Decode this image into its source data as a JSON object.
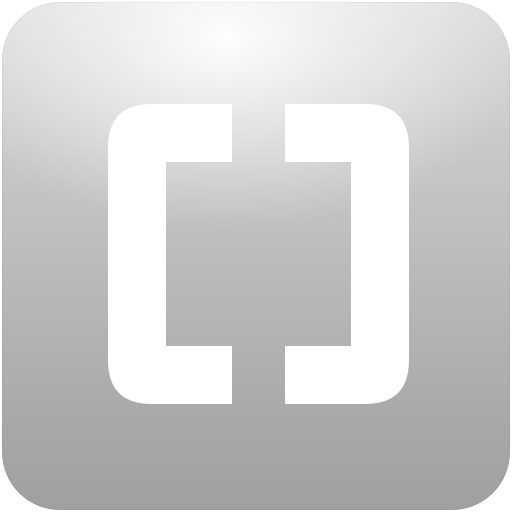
{
  "app_icon": {
    "icon": "brackets-icon",
    "glyph_color": "#ffffff",
    "background_top_color": "#dcdcdd",
    "background_bottom_color": "#a0a0a1"
  }
}
